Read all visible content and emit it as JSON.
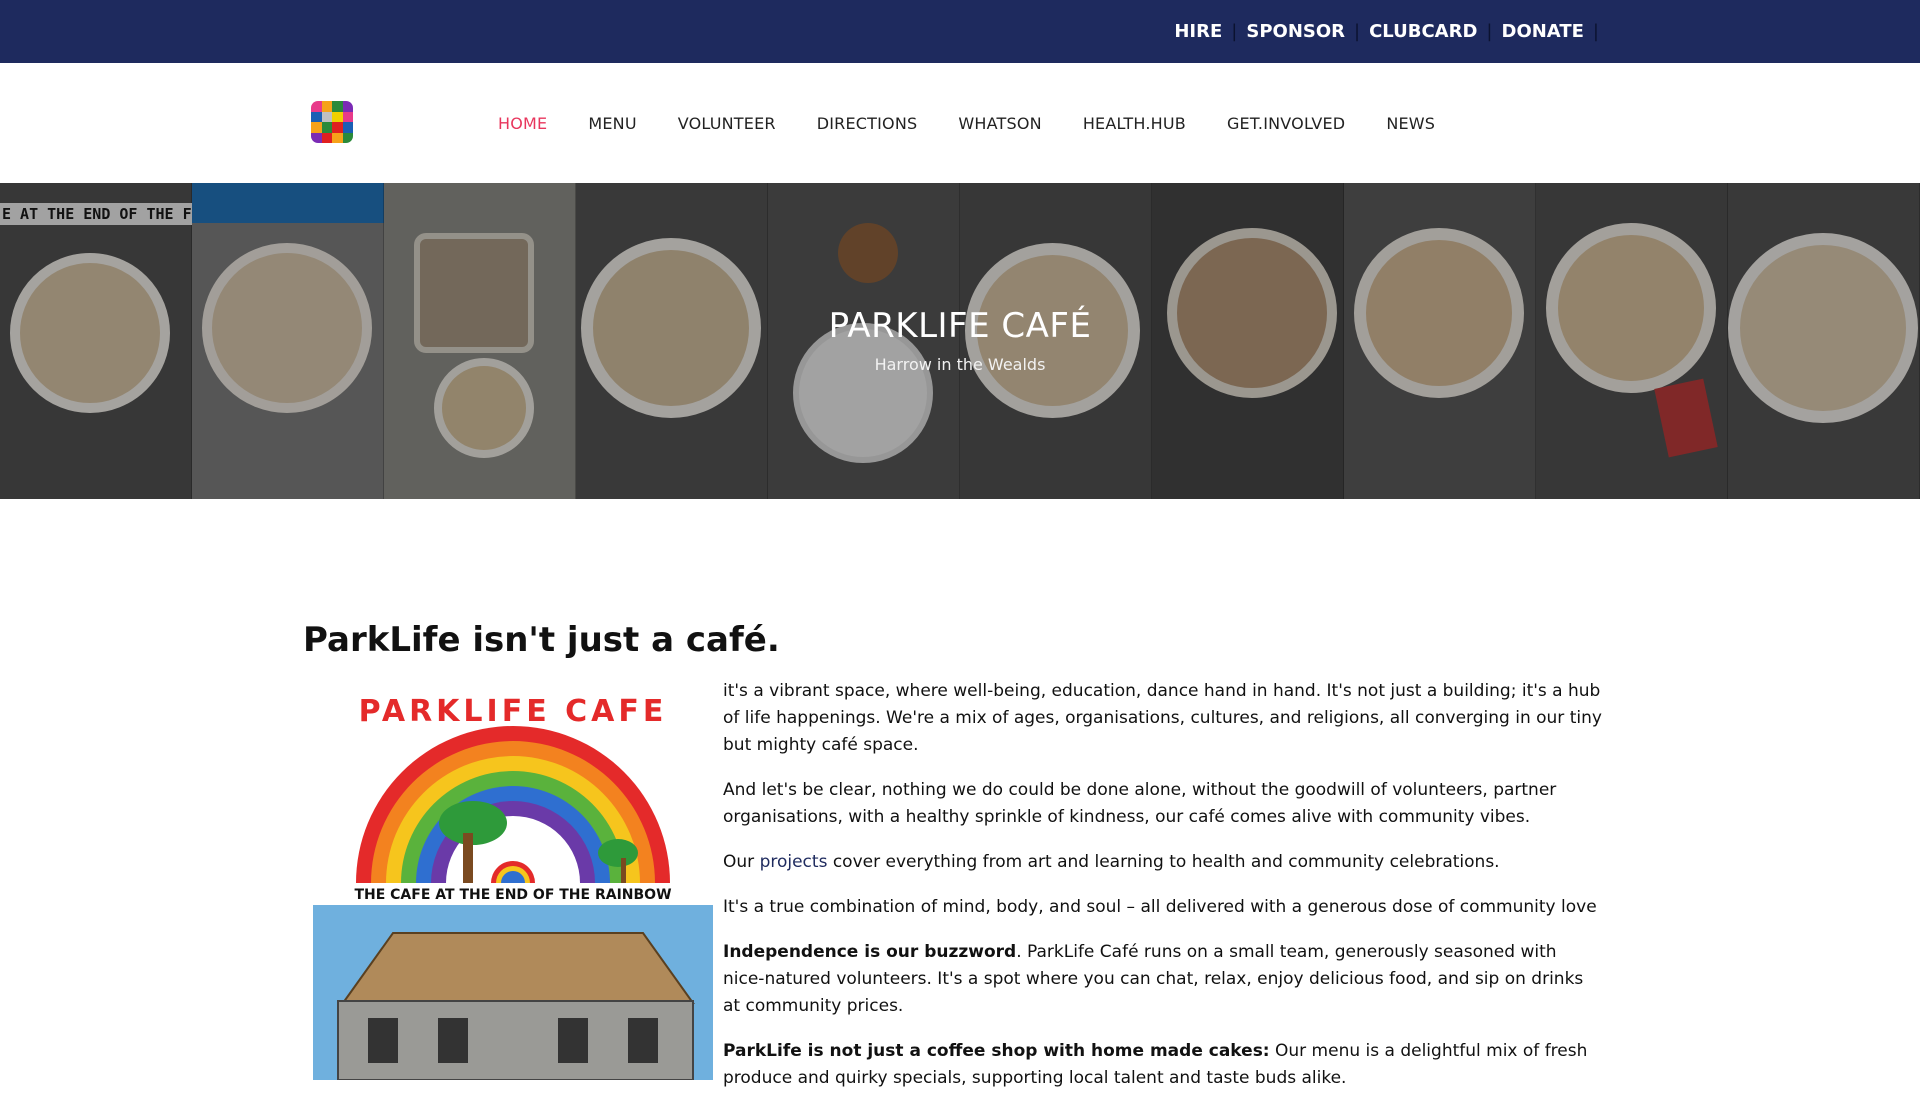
{
  "topbar": {
    "links": [
      "HIRE",
      "SPONSOR",
      "CLUBCARD",
      "DONATE"
    ],
    "separator": "|"
  },
  "nav": {
    "items": [
      "HOME",
      "MENU",
      "VOLUNTEER",
      "DIRECTIONS",
      "WHATSON",
      "HEALTH.HUB",
      "GET.INVOLVED",
      "NEWS"
    ],
    "active": "HOME"
  },
  "hero": {
    "title": "PARKLIFE CAFÉ",
    "subtitle": "Harrow in the Wealds",
    "sign_text": "E AT THE END OF THE F"
  },
  "main": {
    "heading": "ParkLife isn't just a café.",
    "feature_logo_text": "PARKLIFE CAFE",
    "feature_banner": "THE CAFE AT THE END OF THE RAINBOW",
    "p1": "it's a vibrant space, where well-being, education, dance hand in hand. It's not just a building; it's a hub of life happenings. We're a mix of ages, organisations, cultures, and religions, all converging in our tiny but mighty café space.",
    "p2": "And let's be clear, nothing we do could be done alone, without the goodwill of volunteers, partner organisations, with a healthy sprinkle of kindness, our café comes alive with community vibes.",
    "p3_before": "Our ",
    "p3_link": "projects",
    "p3_after": " cover everything from art and learning to health and community celebrations.",
    "p4": "It's a true combination of mind, body, and soul – all delivered with a generous dose of community love",
    "p5_bold": "Independence is our buzzword",
    "p5_rest": ". ParkLife Café runs on a small team, generously seasoned with nice-natured volunteers. It's a spot where you can chat, relax, enjoy delicious food, and sip on drinks at community prices.",
    "p6_bold": "ParkLife is not just a coffee shop with home made cakes:",
    "p6_rest": " Our menu is a delightful mix of fresh produce and quirky specials, supporting local talent and taste buds alike."
  },
  "colors": {
    "topbar": "#1e2a5e",
    "nav_active": "#e8365d",
    "link": "#1e2a5e"
  }
}
